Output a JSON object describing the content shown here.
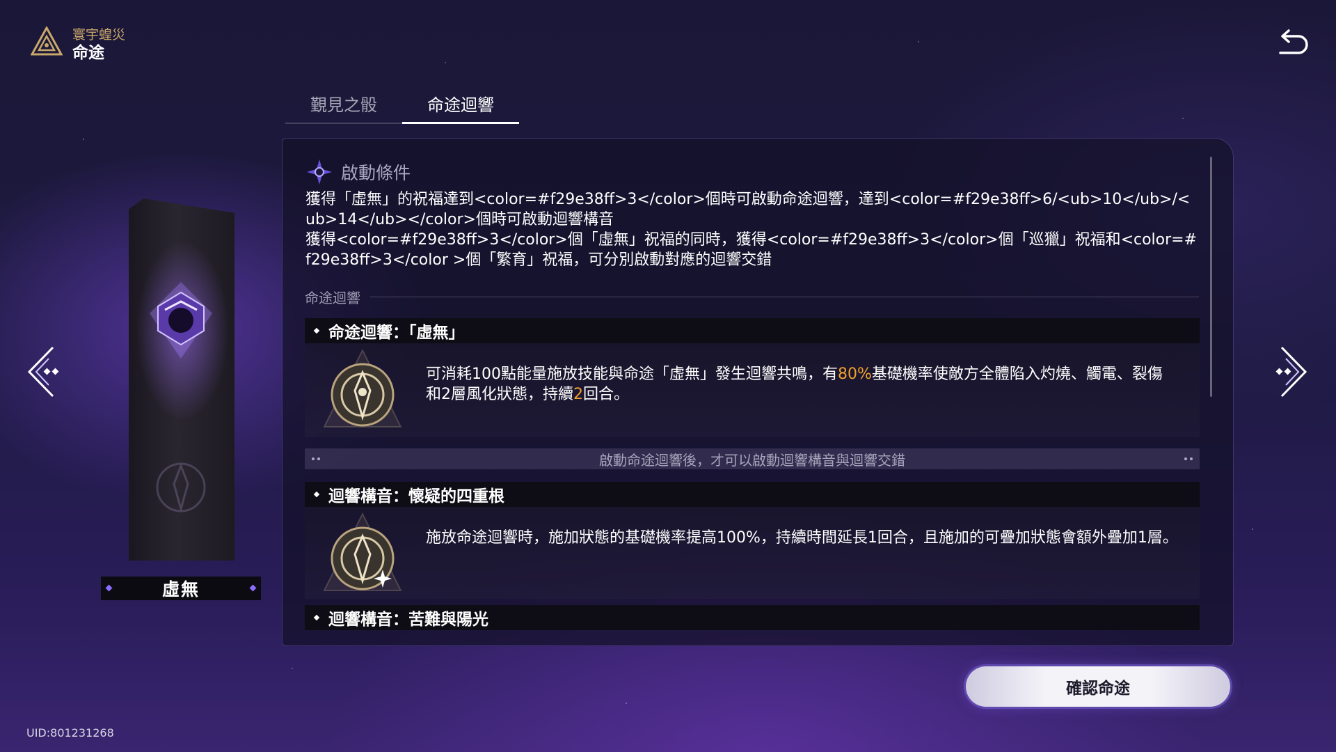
{
  "header": {
    "subtitle": "寰宇蝗災",
    "title": "命途"
  },
  "icons": {
    "brand": "triangle-logo-icon",
    "back": "return-icon",
    "condition": "star-compass-icon",
    "prev": "chevron-left-icon",
    "next": "chevron-right-icon"
  },
  "tabs": [
    {
      "label": "覲見之骰"
    },
    {
      "label": "命途迴響"
    }
  ],
  "active_tab": 1,
  "path": {
    "name": "虛無"
  },
  "panel": {
    "condition_title": "啟動條件",
    "condition_lines": [
      "獲得「虛無」的祝福達到<color=#f29e38ff>3</color>個時可啟動命途迴響，達到<color=#f29e38ff>6/<ub>10</ub>/<ub>14</ub></color>個時可啟動迴響構音",
      "獲得<color=#f29e38ff>3</color>個「虛無」祝福的同時，獲得<color=#f29e38ff>3</color>個「巡獵」祝福和<color=#f29e38ff>3</color >個「繁育」祝福，可分別啟動對應的迴響交錯"
    ],
    "section_label": "命途迴響",
    "resonance": {
      "title": "命途迴響：「虛無」",
      "desc_a": "可消耗100點能量施放技能與命途「虛無」發生迴響共鳴，有",
      "desc_hl1": "80%",
      "desc_b": "基礎機率使敵方全體陷入灼燒、觸電、裂傷和2層風化狀態，持續",
      "desc_hl2": "2",
      "desc_c": "回合。"
    },
    "notice": "啟動命途迴響後，才可以啟動迴響構音與迴響交錯",
    "formations": [
      {
        "title": "迴響構音：懷疑的四重根",
        "desc": "施放命途迴響時，施加狀態的基礎機率提高100%，持續時間延長1回合，且施加的可疊加狀態會額外疊加1層。"
      },
      {
        "title": "迴響構音：苦難與陽光"
      }
    ]
  },
  "confirm_label": "確認命途",
  "uid": "UID:801231268",
  "colors": {
    "highlight": "#f2a12d",
    "accent": "#8a6cff",
    "gold": "#c9a86a"
  }
}
